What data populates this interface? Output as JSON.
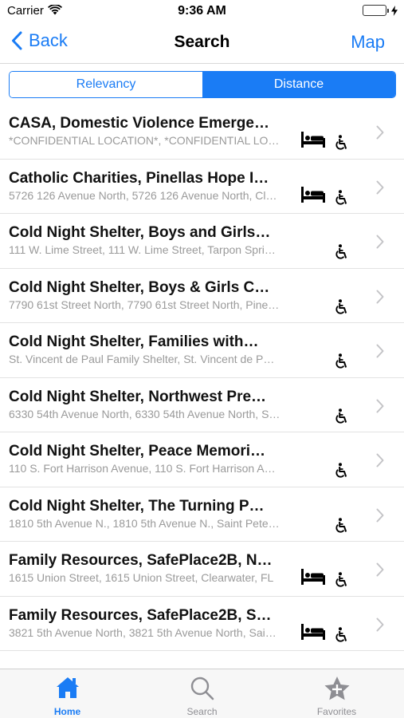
{
  "status_bar": {
    "carrier": "Carrier",
    "time": "9:36 AM"
  },
  "nav": {
    "back_label": "Back",
    "title": "Search",
    "map_label": "Map"
  },
  "segments": {
    "relevancy": "Relevancy",
    "distance": "Distance",
    "selected": "Distance"
  },
  "results": [
    {
      "title": "CASA, Domestic Violence Emerge…",
      "subtitle": "*CONFIDENTIAL LOCATION*, *CONFIDENTIAL LO…",
      "beds": true,
      "accessible": true
    },
    {
      "title": "Catholic Charities, Pinellas Hope I…",
      "subtitle": "5726 126 Avenue North, 5726 126 Avenue North, Cl…",
      "beds": true,
      "accessible": true
    },
    {
      "title": "Cold Night Shelter, Boys and Girls…",
      "subtitle": "111 W. Lime Street, 111 W. Lime Street, Tarpon Spri…",
      "beds": false,
      "accessible": true
    },
    {
      "title": "Cold Night Shelter, Boys & Girls C…",
      "subtitle": "7790 61st Street North, 7790 61st Street North, Pine…",
      "beds": false,
      "accessible": true
    },
    {
      "title": "Cold Night Shelter, Families with…",
      "subtitle": "St. Vincent de Paul Family Shelter, St. Vincent de P…",
      "beds": false,
      "accessible": true
    },
    {
      "title": "Cold Night Shelter, Northwest Pre…",
      "subtitle": "6330 54th Avenue North, 6330 54th Avenue North, S…",
      "beds": false,
      "accessible": true
    },
    {
      "title": "Cold Night Shelter, Peace Memori…",
      "subtitle": "110 S. Fort Harrison Avenue, 110 S. Fort Harrison A…",
      "beds": false,
      "accessible": true
    },
    {
      "title": "Cold Night Shelter, The Turning P…",
      "subtitle": "1810 5th Avenue N., 1810 5th Avenue N., Saint Pete…",
      "beds": false,
      "accessible": true
    },
    {
      "title": "Family Resources, SafePlace2B, N…",
      "subtitle": "1615 Union Street, 1615 Union Street, Clearwater, FL",
      "beds": true,
      "accessible": true
    },
    {
      "title": "Family Resources, SafePlace2B, S…",
      "subtitle": "3821 5th Avenue North, 3821 5th Avenue North, Sai…",
      "beds": true,
      "accessible": true
    }
  ],
  "tabs": [
    {
      "label": "Home",
      "icon": "home-icon",
      "active": true
    },
    {
      "label": "Search",
      "icon": "search-icon",
      "active": false
    },
    {
      "label": "Favorites",
      "icon": "star-plus-icon",
      "active": false
    }
  ],
  "colors": {
    "accent": "#1a7cf5",
    "subtitle_gray": "#9a9a9a",
    "battery_green": "#4cd964",
    "tab_inactive": "#8e8e93"
  }
}
